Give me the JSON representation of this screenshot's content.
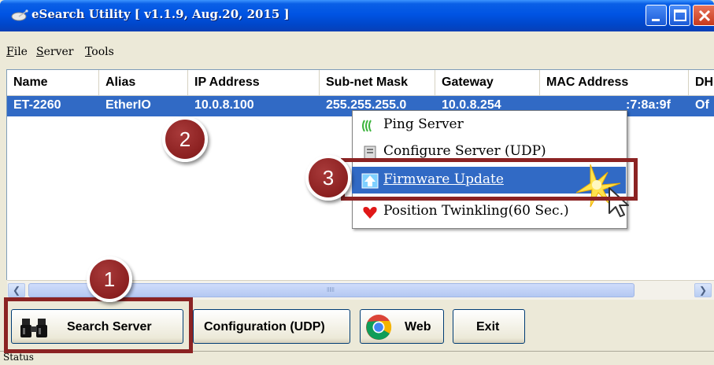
{
  "window": {
    "title": "eSearch Utility [ v1.1.9, Aug.20, 2015 ]"
  },
  "menubar": {
    "items": [
      {
        "label": "File",
        "accel": "F"
      },
      {
        "label": "Server",
        "accel": "S"
      },
      {
        "label": "Tools",
        "accel": "T"
      }
    ]
  },
  "table": {
    "columns": [
      "Name",
      "Alias",
      "IP Address",
      "Sub-net Mask",
      "Gateway",
      "MAC Address",
      "DH"
    ],
    "rows": [
      {
        "name": "ET-2260",
        "alias": "EtherIO",
        "ip": "10.0.8.100",
        "mask": "255.255.255.0",
        "gateway": "10.0.8.254",
        "mac": "00:0d:e0:__:7:8a:9f",
        "mac_visible": ":7:8a:9f",
        "dhcp": "Of"
      }
    ]
  },
  "context_menu": {
    "items": [
      {
        "label": "Ping Server",
        "icon": "ping-icon"
      },
      {
        "label": "Configure Server (UDP)",
        "icon": "configure-icon"
      },
      {
        "label": "Firmware Update",
        "icon": "firmware-update-icon",
        "highlighted": true
      },
      {
        "label": "Position Twinkling(60 Sec.)",
        "icon": "heart-icon"
      }
    ]
  },
  "buttons": {
    "search": "Search Server",
    "config": "Configuration (UDP)",
    "web": "Web",
    "exit": "Exit"
  },
  "status": {
    "text": "Status"
  },
  "steps": [
    "1",
    "2",
    "3"
  ],
  "colors": {
    "titlebar": "#0054e3",
    "selection": "#316ac5",
    "highlight_frame": "#8b2323",
    "step_circle": "#8b2020"
  }
}
